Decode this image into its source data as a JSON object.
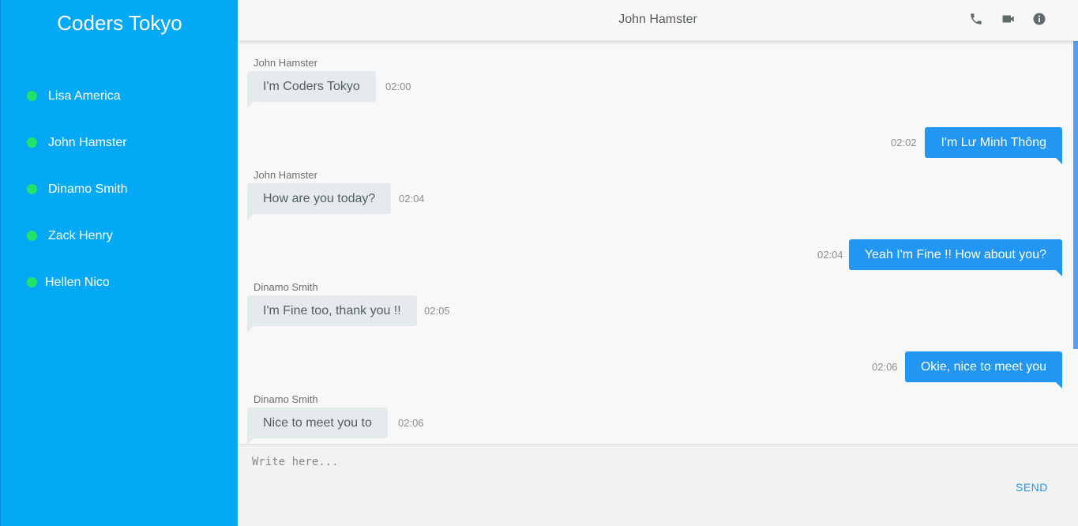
{
  "brand": "Coders Tokyo",
  "contacts": [
    {
      "name": "Lisa America",
      "online": true
    },
    {
      "name": "John Hamster",
      "online": true
    },
    {
      "name": "Dinamo Smith",
      "online": true
    },
    {
      "name": "Zack Henry",
      "online": true
    },
    {
      "name": "Hellen Nico",
      "online": true
    }
  ],
  "header": {
    "title": "John Hamster",
    "icons": [
      "phone-icon",
      "video-camera-icon",
      "info-icon"
    ]
  },
  "messages": [
    {
      "direction": "in",
      "sender": "John Hamster",
      "text": "I'm Coders Tokyo",
      "time": "02:00"
    },
    {
      "direction": "out",
      "text": "I'm Lư Minh Thông",
      "time": "02:02"
    },
    {
      "direction": "in",
      "sender": "John Hamster",
      "text": "How are you today?",
      "time": "02:04"
    },
    {
      "direction": "out",
      "text": "Yeah I'm Fine !! How about you?",
      "time": "02:04"
    },
    {
      "direction": "in",
      "sender": "Dinamo Smith",
      "text": "I'm Fine too, thank you !!",
      "time": "02:05"
    },
    {
      "direction": "out",
      "text": "Okie, nice to meet you",
      "time": "02:06"
    },
    {
      "direction": "in",
      "sender": "Dinamo Smith",
      "text": "Nice to meet you to",
      "time": "02:06"
    }
  ],
  "composer": {
    "placeholder": "Write here...",
    "value": "",
    "send_label": "SEND"
  },
  "colors": {
    "sidebar": "#03a9f4",
    "online": "#20e36a",
    "outgoing_bubble": "#2196f3",
    "incoming_bubble": "#e5ebec",
    "send": "#2196f3"
  }
}
